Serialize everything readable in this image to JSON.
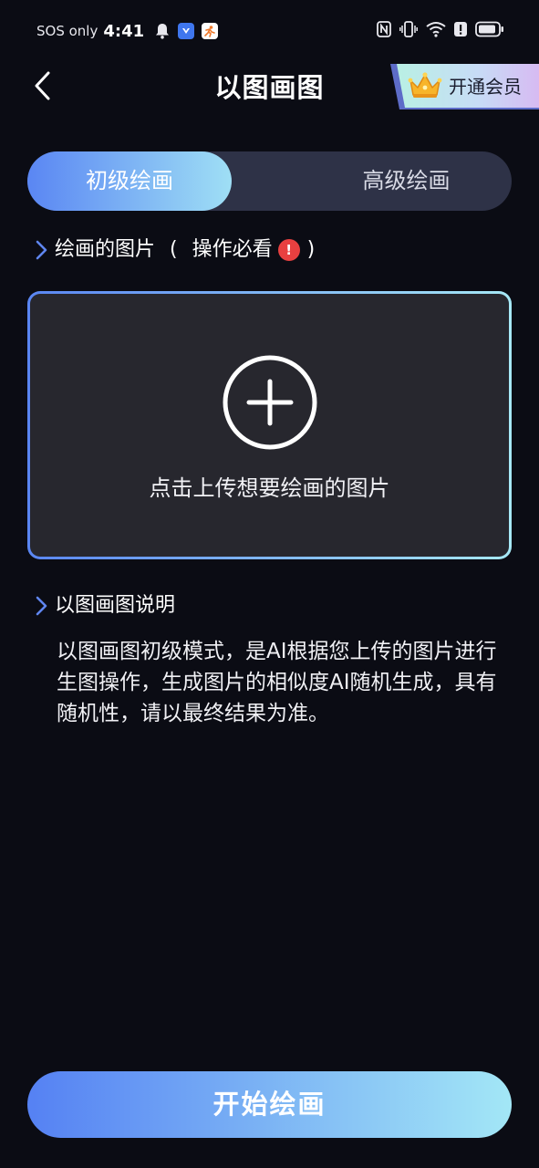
{
  "status_bar": {
    "carrier": "SOS only",
    "time": "4:41",
    "icons": [
      "bell-icon",
      "app-notification-icon",
      "app-notification-icon",
      "nfc-icon",
      "vibrate-icon",
      "wifi-icon",
      "alert-icon",
      "battery-icon"
    ]
  },
  "header": {
    "title": "以图画图",
    "vip_label": "开通会员"
  },
  "tabs": [
    {
      "label": "初级绘画",
      "active": true
    },
    {
      "label": "高级绘画",
      "active": false
    }
  ],
  "upload_section": {
    "heading": "绘画的图片",
    "paren_open": "(",
    "note": "操作必看",
    "paren_close": ")",
    "hint": "点击上传想要绘画的图片"
  },
  "description": {
    "heading": "以图画图说明",
    "body": "以图画图初级模式，是AI根据您上传的图片进行生图操作，生成图片的相似度AI随机生成，具有随机性，请以最终结果为准。"
  },
  "start_button": {
    "label": "开始绘画"
  },
  "colors": {
    "background": "#0b0c14",
    "accent_start": "#5581f3",
    "accent_end": "#a3e7f6",
    "panel": "#27272e",
    "warning": "#e84040"
  }
}
